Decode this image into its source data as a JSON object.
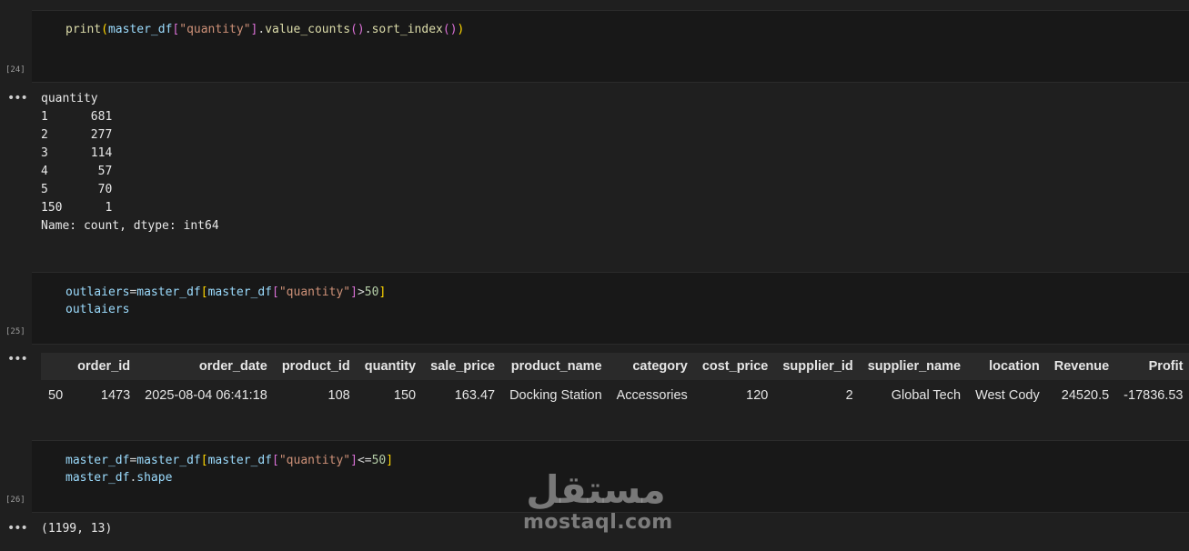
{
  "cells": [
    {
      "exec_count": "[24]",
      "code": {
        "line1": {
          "p1": "print",
          "p2": "(",
          "p3": "master_df",
          "p4": "[",
          "p5": "\"quantity\"",
          "p6": "]",
          "p7": ".",
          "p8": "value_counts",
          "p9": "()",
          "p10": ".",
          "p11": "sort_index",
          "p12": "()",
          "p13": ")"
        }
      },
      "output_lines": [
        "quantity",
        "1      681",
        "2      277",
        "3      114",
        "4       57",
        "5       70",
        "150      1",
        "Name: count, dtype: int64"
      ]
    },
    {
      "exec_count": "[25]",
      "code": {
        "line1": {
          "p1": "outlaiers",
          "p2": "=",
          "p3": "master_df",
          "p4": "[",
          "p5": "master_df",
          "p6": "[",
          "p7": "\"quantity\"",
          "p8": "]",
          "p9": ">",
          "p10": "50",
          "p11": "]"
        },
        "line2": "outlaiers"
      },
      "table": {
        "columns": [
          "",
          "order_id",
          "order_date",
          "product_id",
          "quantity",
          "sale_price",
          "product_name",
          "category",
          "cost_price",
          "supplier_id",
          "supplier_name",
          "location",
          "Revenue",
          "Profit"
        ],
        "rows": [
          [
            "50",
            "1473",
            "2025-08-04 06:41:18",
            "108",
            "150",
            "163.47",
            "Docking Station",
            "Accessories",
            "120",
            "2",
            "Global Tech",
            "West Cody",
            "24520.5",
            "-17836.53"
          ]
        ]
      }
    },
    {
      "exec_count": "[26]",
      "code": {
        "line1": {
          "p1": "master_df",
          "p2": "=",
          "p3": "master_df",
          "p4": "[",
          "p5": "master_df",
          "p6": "[",
          "p7": "\"quantity\"",
          "p8": "]",
          "p9": "<=",
          "p10": "50",
          "p11": "]"
        },
        "line2": {
          "p1": "master_df",
          "p2": ".",
          "p3": "shape"
        }
      },
      "output_lines": [
        "(1199, 13)"
      ]
    }
  ],
  "output_indicator": "•••",
  "watermark": {
    "arabic": "مستقل",
    "latin": "mostaql.com"
  }
}
